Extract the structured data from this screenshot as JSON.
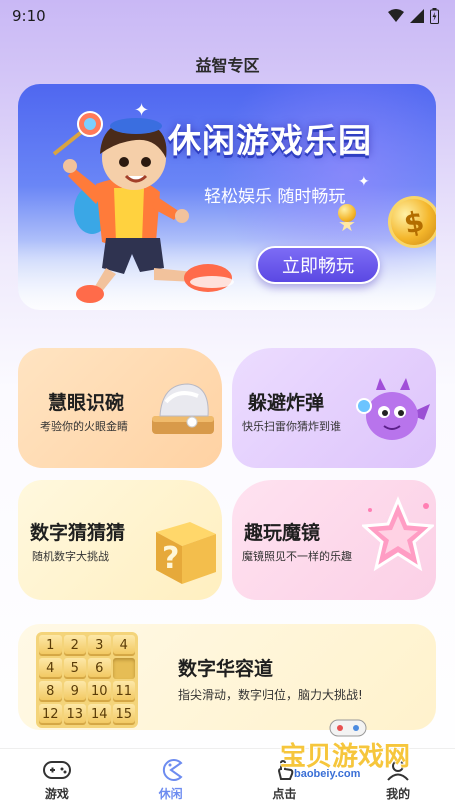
{
  "status": {
    "time": "9:10"
  },
  "page": {
    "title": "益智专区"
  },
  "banner": {
    "title": "休闲游戏乐园",
    "subtitle": "轻松娱乐 随时畅玩",
    "button": "立即畅玩",
    "coin_symbol": "$"
  },
  "cards": [
    {
      "title": "慧眼识碗",
      "desc": "考验你的火眼金睛"
    },
    {
      "title": "躲避炸弹",
      "desc": "快乐扫雷你猜炸到谁"
    },
    {
      "title": "数字猜猜猜",
      "desc": "随机数字大挑战",
      "icon_char": "?"
    },
    {
      "title": "趣玩魔镜",
      "desc": "魔镜照见不一样的乐趣"
    },
    {
      "title": "数字华容道",
      "desc": "指尖滑动，数字归位，脑力大挑战!"
    }
  ],
  "puzzle": {
    "tiles": [
      "1",
      "2",
      "3",
      "4",
      "4",
      "5",
      "6",
      "",
      "8",
      "9",
      "10",
      "11",
      "12",
      "13",
      "14",
      "15"
    ]
  },
  "tabs": [
    {
      "label": "游戏",
      "icon": "gamepad-icon"
    },
    {
      "label": "休闲",
      "icon": "pacman-icon",
      "active": true
    },
    {
      "label": "点击",
      "icon": "tap-icon"
    },
    {
      "label": "我的",
      "icon": "user-icon"
    }
  ],
  "watermark": {
    "text": "宝贝游戏网",
    "url": "baobeiy.com"
  },
  "colors": {
    "accent": "#6d8cf0",
    "banner": "#5b6ff0"
  }
}
